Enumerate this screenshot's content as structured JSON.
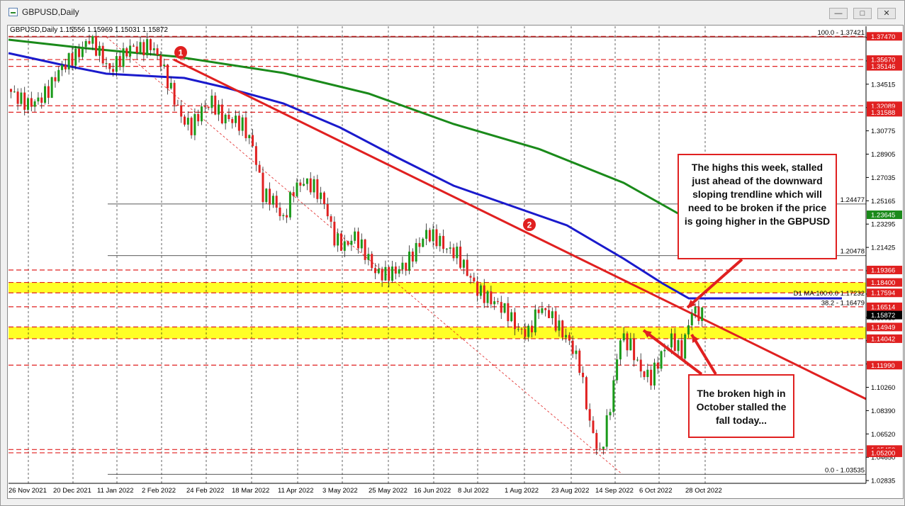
{
  "window": {
    "title": "GBPUSD,Daily",
    "minimize_label": "—",
    "maximize_label": "□",
    "close_label": "✕"
  },
  "chart_header": "GBPUSD,Daily  1.15556 1.15969 1.15031 1.15872",
  "price_axis": [
    "1.38255",
    "1.36385",
    "1.34515",
    "1.32645",
    "1.30775",
    "1.28905",
    "1.27035",
    "1.25165",
    "1.23295",
    "1.21425",
    "1.19555",
    "1.17685",
    "1.15815",
    "1.13945",
    "1.12075",
    "1.10260",
    "1.08390",
    "1.06520",
    "1.04650",
    "1.02835"
  ],
  "badges": [
    {
      "label": "1.37470",
      "value": 1.3747,
      "color": "#e02020"
    },
    {
      "label": "1.35670",
      "value": 1.3567,
      "color": "#e02020"
    },
    {
      "label": "1.35146",
      "value": 1.35146,
      "color": "#e02020"
    },
    {
      "label": "1.32089",
      "value": 1.32089,
      "color": "#e02020"
    },
    {
      "label": "1.31588",
      "value": 1.31588,
      "color": "#e02020"
    },
    {
      "label": "1.23645",
      "value": 1.23645,
      "color": "#1a8a1a"
    },
    {
      "label": "1.19366",
      "value": 1.19366,
      "color": "#e02020"
    },
    {
      "label": "1.18400",
      "value": 1.184,
      "color": "#e02020"
    },
    {
      "label": "1.17594",
      "value": 1.17594,
      "color": "#e02020"
    },
    {
      "label": "1.16514",
      "value": 1.16514,
      "color": "#e02020"
    },
    {
      "label": "1.15872",
      "value": 1.15872,
      "color": "#000000"
    },
    {
      "label": "1.14949",
      "value": 1.14949,
      "color": "#e02020"
    },
    {
      "label": "1.14042",
      "value": 1.14042,
      "color": "#e02020"
    },
    {
      "label": "1.11990",
      "value": 1.1199,
      "color": "#e02020"
    },
    {
      "label": "1.05453",
      "value": 1.05453,
      "color": "#e02020"
    },
    {
      "label": "1.05200",
      "value": 1.052,
      "color": "#e02020"
    }
  ],
  "line_labels": [
    {
      "text": "100.0 - 1.37421",
      "value": 1.37421
    },
    {
      "text": "1.24477",
      "value": 1.24477
    },
    {
      "text": "1.20478",
      "value": 1.20478
    },
    {
      "text": "D1 MA:100:0:0  1.17232",
      "value": 1.17232
    },
    {
      "text": "38.2 - 1.16479",
      "value": 1.16479
    },
    {
      "text": "0.0 - 1.03535",
      "value": 1.03535
    }
  ],
  "date_axis": [
    "26 Nov 2021",
    "20 Dec 2021",
    "11 Jan 2022",
    "2 Feb 2022",
    "24 Feb 2022",
    "18 Mar 2022",
    "11 Apr 2022",
    "3 May 2022",
    "25 May 2022",
    "16 Jun 2022",
    "8 Jul 2022",
    "1 Aug 2022",
    "23 Aug 2022",
    "14 Sep 2022",
    "6 Oct 2022",
    "28 Oct 2022"
  ],
  "markers": [
    {
      "label": "1"
    },
    {
      "label": "2"
    }
  ],
  "notes": {
    "top": "The highs this week, stalled just ahead of the downward sloping trendline which will need to be broken if the price is going higher in the GBPUSD",
    "bottom": "The broken high in October stalled the fall today..."
  },
  "colors": {
    "trend": "#e02020",
    "ma100": "#1a1acc",
    "ma200": "#1a8a1a",
    "candle_up": "#1a9a1a",
    "candle_down": "#e02020",
    "zone": "#ffff00"
  },
  "chart_data": {
    "type": "candlestick",
    "title": "GBPUSD,Daily",
    "ylim": [
      1.02835,
      1.38255
    ],
    "x": [
      "26 Nov 2021",
      "20 Dec 2021",
      "11 Jan 2022",
      "2 Feb 2022",
      "24 Feb 2022",
      "18 Mar 2022",
      "11 Apr 2022",
      "3 May 2022",
      "25 May 2022",
      "16 Jun 2022",
      "8 Jul 2022",
      "1 Aug 2022",
      "23 Aug 2022",
      "14 Sep 2022",
      "6 Oct 2022",
      "28 Oct 2022"
    ],
    "price_path": [
      1.334,
      1.327,
      1.322,
      1.325,
      1.333,
      1.348,
      1.356,
      1.362,
      1.373,
      1.362,
      1.348,
      1.357,
      1.366,
      1.365,
      1.368,
      1.355,
      1.333,
      1.312,
      1.304,
      1.318,
      1.324,
      1.312,
      1.31,
      1.306,
      1.29,
      1.252,
      1.248,
      1.232,
      1.256,
      1.262,
      1.258,
      1.246,
      1.218,
      1.212,
      1.22,
      1.207,
      1.192,
      1.19,
      1.193,
      1.198,
      1.21,
      1.222,
      1.218,
      1.21,
      1.206,
      1.192,
      1.178,
      1.172,
      1.167,
      1.16,
      1.147,
      1.145,
      1.164,
      1.16,
      1.149,
      1.138,
      1.12,
      1.075,
      1.05,
      1.088,
      1.142,
      1.135,
      1.115,
      1.11,
      1.128,
      1.14,
      1.13,
      1.162,
      1.15872
    ],
    "horizontal_levels": [
      1.3747,
      1.3567,
      1.35146,
      1.32089,
      1.31588,
      1.19366,
      1.184,
      1.17594,
      1.16514,
      1.14949,
      1.14042,
      1.1199,
      1.05453,
      1.052
    ],
    "zones": [
      [
        1.17594,
        1.184
      ],
      [
        1.14042,
        1.14949
      ]
    ],
    "fib_levels": [
      1.37421,
      1.16479,
      1.03535
    ],
    "ma100_last": 1.17232,
    "last_price": 1.15872
  }
}
